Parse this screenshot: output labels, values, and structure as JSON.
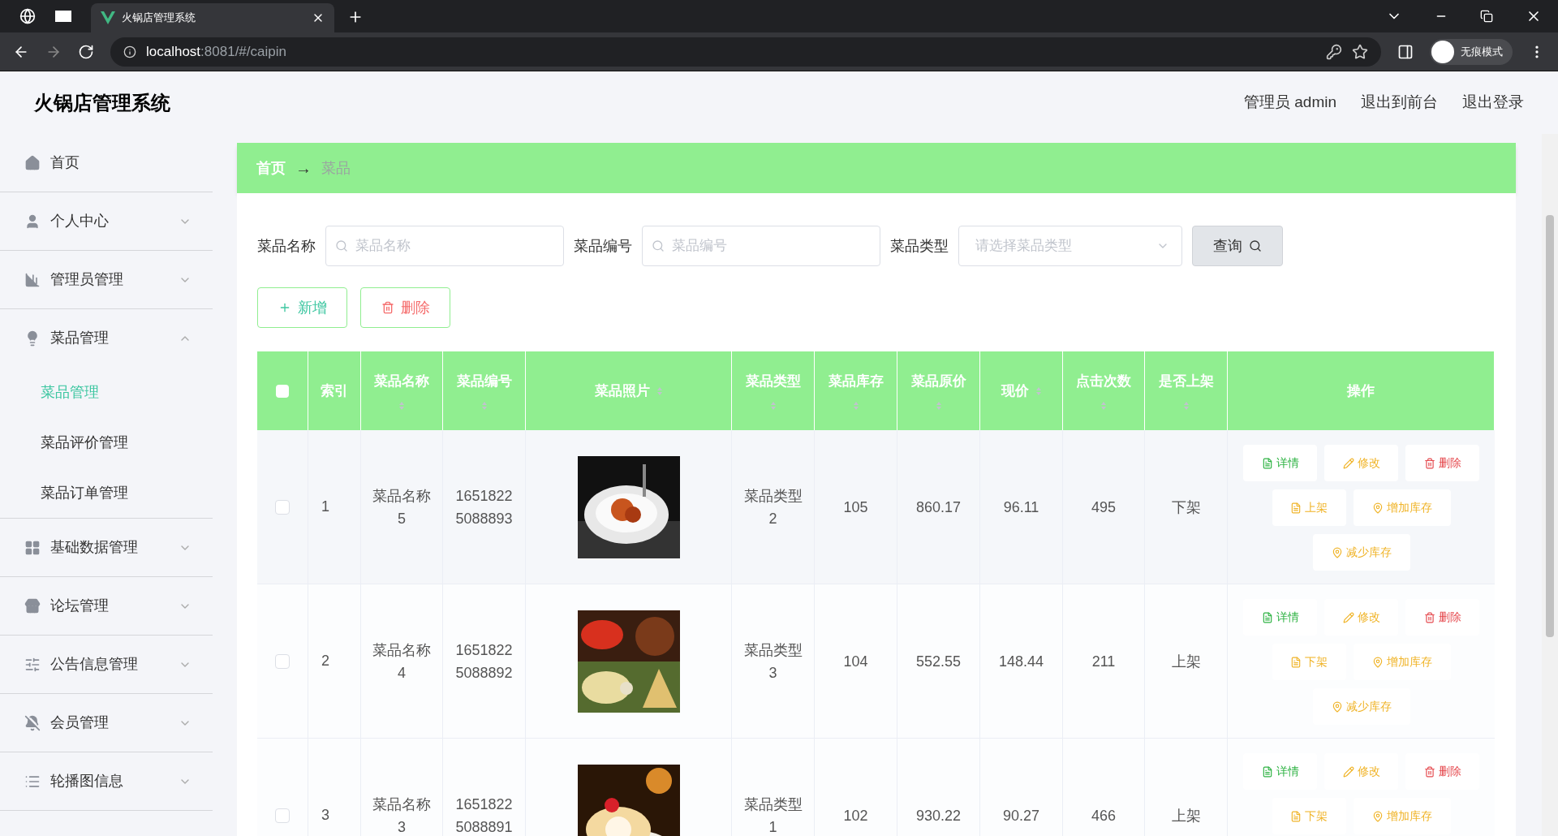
{
  "browser": {
    "tab_title": "火锅店管理系统",
    "url_host": "localhost",
    "url_path": ":8081/#/caipin",
    "profile_label": "无痕模式"
  },
  "header": {
    "title": "火锅店管理系统",
    "links": [
      "管理员 admin",
      "退出到前台",
      "退出登录"
    ]
  },
  "sidebar": {
    "items": [
      {
        "label": "首页"
      },
      {
        "label": "个人中心",
        "expanded": false
      },
      {
        "label": "管理员管理",
        "expanded": false
      },
      {
        "label": "菜品管理",
        "expanded": true,
        "children": [
          {
            "label": "菜品管理",
            "selected": true
          },
          {
            "label": "菜品评价管理",
            "selected": false
          },
          {
            "label": "菜品订单管理",
            "selected": false
          }
        ]
      },
      {
        "label": "基础数据管理",
        "expanded": false
      },
      {
        "label": "论坛管理",
        "expanded": false
      },
      {
        "label": "公告信息管理",
        "expanded": false
      },
      {
        "label": "会员管理",
        "expanded": false
      },
      {
        "label": "轮播图信息",
        "expanded": false
      }
    ]
  },
  "breadcrumb": {
    "home": "首页",
    "arrow": "→",
    "current": "菜品"
  },
  "filters": [
    {
      "label": "菜品名称",
      "kind": "search",
      "placeholder": "菜品名称"
    },
    {
      "label": "菜品编号",
      "kind": "search",
      "placeholder": "菜品编号"
    },
    {
      "label": "菜品类型",
      "kind": "select",
      "placeholder": "请选择菜品类型"
    }
  ],
  "query_button": "查询",
  "action_buttons": [
    {
      "label": "新增",
      "kind": "add"
    },
    {
      "label": "删除",
      "kind": "delete"
    }
  ],
  "table": {
    "select_all": false,
    "columns": [
      "索引",
      "菜品名称",
      "菜品编号",
      "菜品照片",
      "菜品类型",
      "菜品库存",
      "菜品原价",
      "现价",
      "点击次数",
      "是否上架",
      "操作"
    ],
    "rows": [
      {
        "checked": false,
        "index": "1",
        "name": [
          "菜品名称",
          "5"
        ],
        "code": [
          "1651822",
          "5088893"
        ],
        "photo": {
          "kind": "picture"
        },
        "type": [
          "菜品类型",
          "2"
        ],
        "stock": "105",
        "price": "860.17",
        "current_price": "96.11",
        "clicks": "495",
        "status": "下架",
        "actions": [
          {
            "label": "详情",
            "kind": "detail"
          },
          {
            "label": "修改",
            "kind": "edit"
          },
          {
            "label": "删除",
            "kind": "delete"
          },
          {
            "label": "上架",
            "kind": "toggle"
          },
          {
            "label": "增加库存",
            "kind": "add-stock"
          },
          {
            "label": "减少库存",
            "kind": "reduce-stock"
          }
        ]
      },
      {
        "checked": false,
        "index": "2",
        "name": [
          "菜品名称",
          "4"
        ],
        "code": [
          "1651822",
          "5088892"
        ],
        "photo": {
          "kind": "picture"
        },
        "type": [
          "菜品类型",
          "3"
        ],
        "stock": "104",
        "price": "552.55",
        "current_price": "148.44",
        "clicks": "211",
        "status": "上架",
        "actions": [
          {
            "label": "详情",
            "kind": "detail"
          },
          {
            "label": "修改",
            "kind": "edit"
          },
          {
            "label": "删除",
            "kind": "delete"
          },
          {
            "label": "下架",
            "kind": "toggle"
          },
          {
            "label": "增加库存",
            "kind": "add-stock"
          },
          {
            "label": "减少库存",
            "kind": "reduce-stock"
          }
        ]
      },
      {
        "checked": false,
        "index": "3",
        "name": [
          "菜品名称",
          "3"
        ],
        "code": [
          "1651822",
          "5088891"
        ],
        "photo": {
          "kind": "picture"
        },
        "type": [
          "菜品类型",
          "1"
        ],
        "stock": "102",
        "price": "930.22",
        "current_price": "90.27",
        "clicks": "466",
        "status": "上架",
        "actions": [
          {
            "label": "详情",
            "kind": "detail"
          },
          {
            "label": "修改",
            "kind": "edit"
          },
          {
            "label": "删除",
            "kind": "delete"
          },
          {
            "label": "下架",
            "kind": "toggle"
          },
          {
            "label": "增加库存",
            "kind": "add-stock"
          }
        ]
      }
    ]
  }
}
